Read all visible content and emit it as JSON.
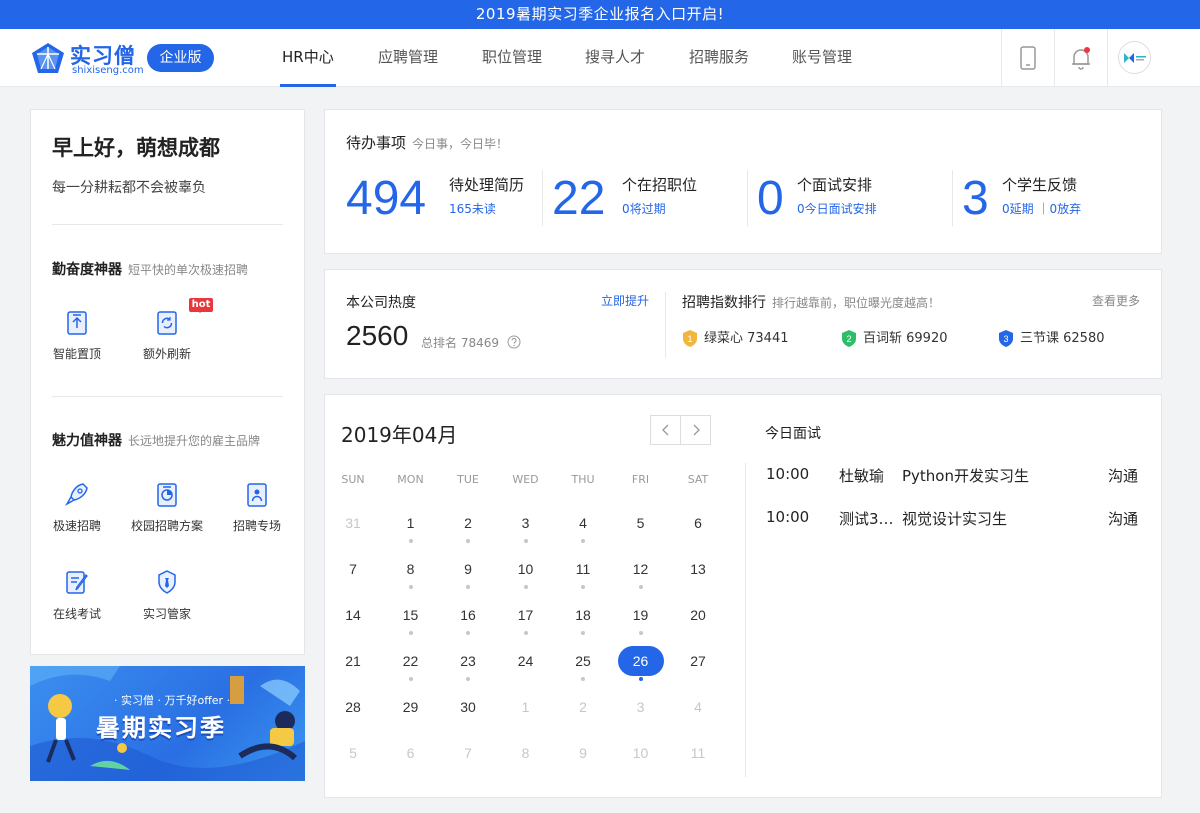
{
  "banner": {
    "text": "2019暑期实习季企业报名入口开启!"
  },
  "header": {
    "logo_cn": "实习僧",
    "logo_en": "shixiseng.com",
    "edition": "企业版",
    "nav": [
      {
        "label": "HR中心",
        "active": true
      },
      {
        "label": "应聘管理",
        "active": false
      },
      {
        "label": "职位管理",
        "active": false
      },
      {
        "label": "搜寻人才",
        "active": false
      },
      {
        "label": "招聘服务",
        "active": false
      },
      {
        "label": "账号管理",
        "active": false
      }
    ],
    "icons": [
      "mobile-icon",
      "bell-icon",
      "company-avatar"
    ]
  },
  "sidebar": {
    "greeting": "早上好，萌想成都",
    "motto": "每一分耕耘都不会被辜负",
    "diligence": {
      "title": "勤奋度神器",
      "subtitle": "短平快的单次极速招聘",
      "badge": "hot",
      "tools": [
        {
          "label": "智能置顶",
          "icon": "pin-top-icon"
        },
        {
          "label": "额外刷新",
          "icon": "refresh-icon"
        }
      ]
    },
    "charm": {
      "title": "魅力值神器",
      "subtitle": "长远地提升您的雇主品牌",
      "tools": [
        {
          "label": "极速招聘",
          "icon": "rocket-icon"
        },
        {
          "label": "校园招聘方案",
          "icon": "campus-plan-icon"
        },
        {
          "label": "招聘专场",
          "icon": "job-fair-icon"
        },
        {
          "label": "在线考试",
          "icon": "exam-icon"
        },
        {
          "label": "实习管家",
          "icon": "butler-icon"
        }
      ]
    },
    "promo": {
      "tagline": "· 实习僧 · 万千好offer ·",
      "headline": "暑期实习季"
    }
  },
  "todo": {
    "title": "待办事项",
    "subtitle": "今日事，今日毕！",
    "stats": [
      {
        "value": "494",
        "label": "待处理简历",
        "link": "165未读"
      },
      {
        "value": "22",
        "label": "个在招职位",
        "link": "0将过期"
      },
      {
        "value": "0",
        "label": "个面试安排",
        "link": "0今日面试安排"
      },
      {
        "value": "3",
        "label": "个学生反馈",
        "link": "0延期 ｜0放弃"
      }
    ]
  },
  "heat": {
    "title": "本公司热度",
    "action": "立即提升",
    "score": "2560",
    "rank_label": "总排名 78469",
    "help_icon": "help-circle-icon"
  },
  "ranking": {
    "title": "招聘指数排行",
    "subtitle": "排行越靠前，职位曝光度越高！",
    "more": "查看更多",
    "items": [
      {
        "rank": "1",
        "name": "绿菜心 73441",
        "color": "#f3b63c"
      },
      {
        "rank": "2",
        "name": "百词斩 69920",
        "color": "#2fbd6a"
      },
      {
        "rank": "3",
        "name": "三节课 62580",
        "color": "#2366e8"
      }
    ]
  },
  "calendar": {
    "month_label": "2019年04月",
    "weekdays": [
      "SUN",
      "MON",
      "TUE",
      "WED",
      "THU",
      "FRI",
      "SAT"
    ],
    "days": [
      {
        "d": "31",
        "muted": true,
        "dot": false
      },
      {
        "d": "1",
        "dot": true
      },
      {
        "d": "2",
        "dot": true
      },
      {
        "d": "3",
        "dot": true
      },
      {
        "d": "4",
        "dot": true
      },
      {
        "d": "5",
        "dot": false
      },
      {
        "d": "6",
        "dot": false
      },
      {
        "d": "7",
        "dot": false
      },
      {
        "d": "8",
        "dot": true
      },
      {
        "d": "9",
        "dot": true
      },
      {
        "d": "10",
        "dot": true
      },
      {
        "d": "11",
        "dot": true
      },
      {
        "d": "12",
        "dot": true
      },
      {
        "d": "13",
        "dot": false
      },
      {
        "d": "14",
        "dot": false
      },
      {
        "d": "15",
        "dot": true
      },
      {
        "d": "16",
        "dot": true
      },
      {
        "d": "17",
        "dot": true
      },
      {
        "d": "18",
        "dot": true
      },
      {
        "d": "19",
        "dot": true
      },
      {
        "d": "20",
        "dot": false
      },
      {
        "d": "21",
        "dot": false
      },
      {
        "d": "22",
        "dot": true
      },
      {
        "d": "23",
        "dot": true
      },
      {
        "d": "24",
        "dot": false
      },
      {
        "d": "25",
        "dot": true
      },
      {
        "d": "26",
        "dot": true,
        "today": true
      },
      {
        "d": "27",
        "dot": false
      },
      {
        "d": "28",
        "dot": false
      },
      {
        "d": "29",
        "dot": false
      },
      {
        "d": "30",
        "dot": false
      },
      {
        "d": "1",
        "muted": true
      },
      {
        "d": "2",
        "muted": true
      },
      {
        "d": "3",
        "muted": true
      },
      {
        "d": "4",
        "muted": true
      },
      {
        "d": "5",
        "muted": true
      },
      {
        "d": "6",
        "muted": true
      },
      {
        "d": "7",
        "muted": true
      },
      {
        "d": "8",
        "muted": true
      },
      {
        "d": "9",
        "muted": true
      },
      {
        "d": "10",
        "muted": true
      },
      {
        "d": "11",
        "muted": true
      }
    ]
  },
  "interviews": {
    "title": "今日面试",
    "rows": [
      {
        "time": "10:00",
        "name": "杜敏瑜",
        "position": "Python开发实习生",
        "action": "沟通"
      },
      {
        "time": "10:00",
        "name": "测试3…",
        "position": "视觉设计实习生",
        "action": "沟通"
      }
    ]
  }
}
